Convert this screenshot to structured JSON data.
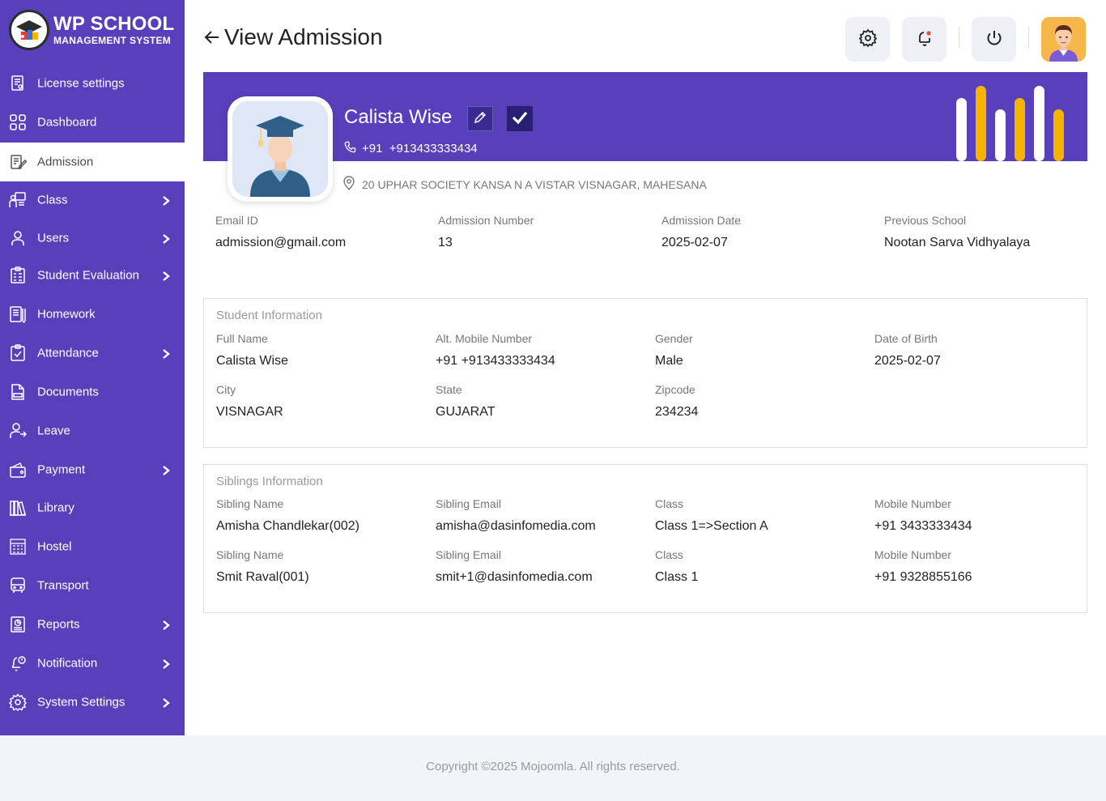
{
  "brand": {
    "title": "WP SCHOOL",
    "subtitle": "MANAGEMENT SYSTEM"
  },
  "sidebar": {
    "items": [
      {
        "label": "License settings",
        "icon": "license-icon",
        "has_submenu": false,
        "active": false
      },
      {
        "label": "Dashboard",
        "icon": "dashboard-icon",
        "has_submenu": false,
        "active": false
      },
      {
        "label": "Admission",
        "icon": "admission-icon",
        "has_submenu": false,
        "active": true
      },
      {
        "label": "Class",
        "icon": "class-icon",
        "has_submenu": true,
        "active": false
      },
      {
        "label": "Users",
        "icon": "users-icon",
        "has_submenu": true,
        "active": false
      },
      {
        "label": "Student Evaluation",
        "icon": "evaluation-icon",
        "has_submenu": true,
        "active": false
      },
      {
        "label": "Homework",
        "icon": "homework-icon",
        "has_submenu": false,
        "active": false
      },
      {
        "label": "Attendance",
        "icon": "attendance-icon",
        "has_submenu": true,
        "active": false
      },
      {
        "label": "Documents",
        "icon": "documents-icon",
        "has_submenu": false,
        "active": false
      },
      {
        "label": "Leave",
        "icon": "leave-icon",
        "has_submenu": false,
        "active": false
      },
      {
        "label": "Payment",
        "icon": "payment-icon",
        "has_submenu": true,
        "active": false
      },
      {
        "label": "Library",
        "icon": "library-icon",
        "has_submenu": false,
        "active": false
      },
      {
        "label": "Hostel",
        "icon": "hostel-icon",
        "has_submenu": false,
        "active": false
      },
      {
        "label": "Transport",
        "icon": "transport-icon",
        "has_submenu": false,
        "active": false
      },
      {
        "label": "Reports",
        "icon": "reports-icon",
        "has_submenu": true,
        "active": false
      },
      {
        "label": "Notification",
        "icon": "notification-icon",
        "has_submenu": true,
        "active": false
      },
      {
        "label": "System Settings",
        "icon": "system-settings-icon",
        "has_submenu": true,
        "active": false
      }
    ]
  },
  "header": {
    "title": "View Admission",
    "icons": [
      "back-arrow-icon",
      "gear-icon",
      "bell-icon",
      "power-icon"
    ]
  },
  "profile": {
    "name": "Calista Wise",
    "phone": "+91  +913433333434",
    "address": "20 UPHAR SOCIETY KANSA N A VISTAR VISNAGAR, MAHESANA"
  },
  "summary": [
    {
      "label": "Email ID",
      "value": "admission@gmail.com"
    },
    {
      "label": "Admission Number",
      "value": "13"
    },
    {
      "label": "Admission Date",
      "value": "2025-02-07"
    },
    {
      "label": "Previous School",
      "value": "Nootan Sarva Vidhyalaya"
    }
  ],
  "student_info": {
    "title": "Student Information",
    "fields": [
      {
        "label": "Full Name",
        "value": "Calista Wise"
      },
      {
        "label": "Alt. Mobile Number",
        "value": "+91 +913433333434"
      },
      {
        "label": "Gender",
        "value": "Male"
      },
      {
        "label": "Date of Birth",
        "value": "2025-02-07"
      },
      {
        "label": "City",
        "value": "VISNAGAR"
      },
      {
        "label": "State",
        "value": "GUJARAT"
      },
      {
        "label": "Zipcode",
        "value": "234234"
      }
    ]
  },
  "siblings": {
    "title": "Siblings Information",
    "rows": [
      [
        {
          "label": "Sibling Name",
          "value": "Amisha Chandlekar(002)"
        },
        {
          "label": "Sibling Email",
          "value": "amisha@dasinfomedia.com"
        },
        {
          "label": "Class",
          "value": "Class 1=>Section A"
        },
        {
          "label": "Mobile Number",
          "value": "+91 3433333434"
        }
      ],
      [
        {
          "label": "Sibling Name",
          "value": "Smit Raval(001)"
        },
        {
          "label": "Sibling Email",
          "value": "smit+1@dasinfomedia.com"
        },
        {
          "label": "Class",
          "value": "Class 1"
        },
        {
          "label": "Mobile Number",
          "value": "+91 9328855166"
        }
      ]
    ]
  },
  "footer": {
    "text": "Copyright ©2025 Mojoomla. All rights reserved."
  },
  "colors": {
    "primary": "#5840bb",
    "accent": "#f5b400",
    "sidebar_active_bg": "#ffffff"
  }
}
